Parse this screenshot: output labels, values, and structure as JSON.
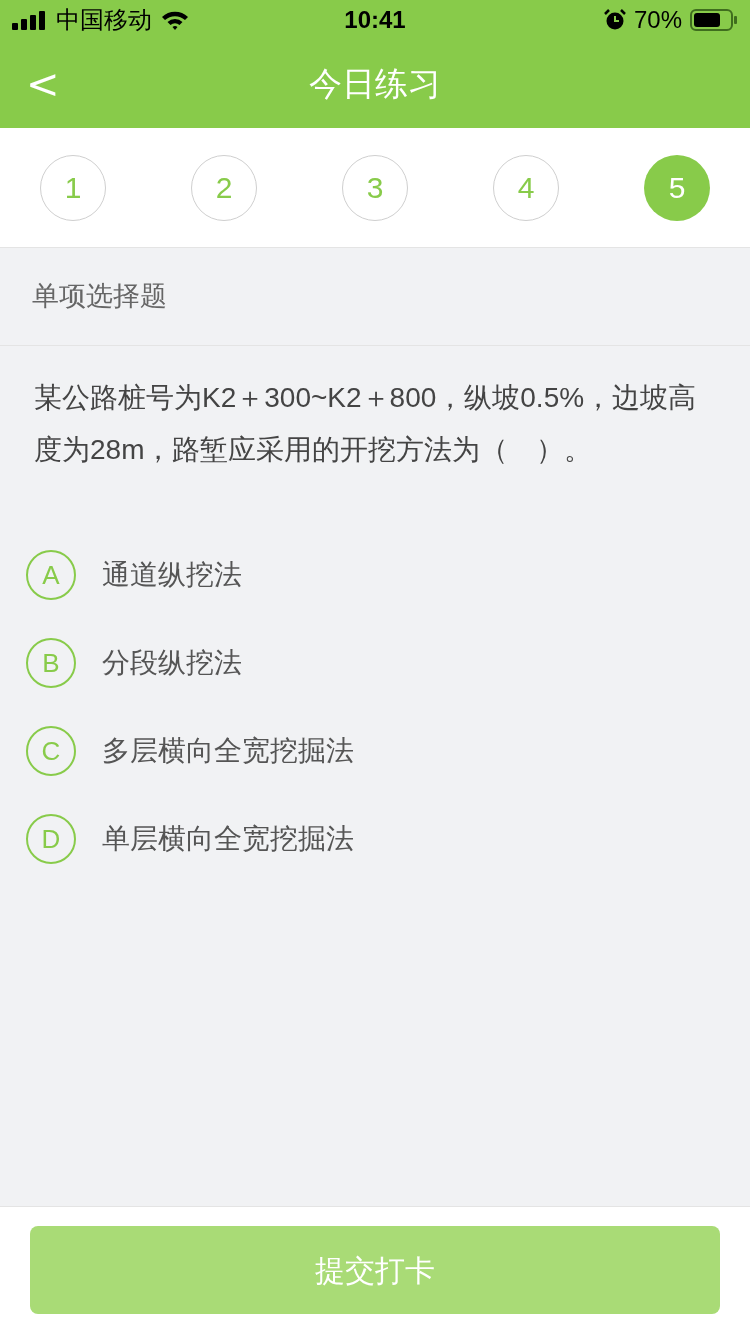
{
  "status_bar": {
    "carrier": "中国移动",
    "time": "10:41",
    "battery": "70%"
  },
  "nav": {
    "back": "<",
    "title": "今日练习"
  },
  "steps": [
    {
      "label": "1",
      "selected": false
    },
    {
      "label": "2",
      "selected": false
    },
    {
      "label": "3",
      "selected": false
    },
    {
      "label": "4",
      "selected": false
    },
    {
      "label": "5",
      "selected": true
    }
  ],
  "question_type": "单项选择题",
  "question": "某公路桩号为K2＋300~K2＋800，纵坡0.5%，边坡高度为28m，路堑应采用的开挖方法为（　）。",
  "options": [
    {
      "letter": "A",
      "text": "通道纵挖法",
      "selected": false
    },
    {
      "letter": "B",
      "text": "分段纵挖法",
      "selected": false
    },
    {
      "letter": "C",
      "text": "多层横向全宽挖掘法",
      "selected": false
    },
    {
      "letter": "D",
      "text": "单层横向全宽挖掘法",
      "selected": false
    }
  ],
  "submit": {
    "label": "提交打卡",
    "disabled": true
  }
}
